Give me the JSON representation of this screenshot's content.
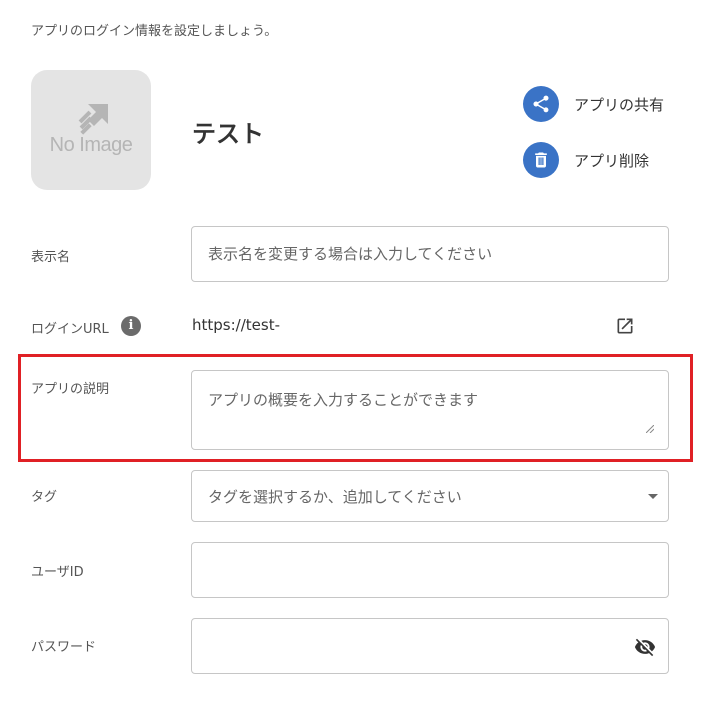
{
  "intro_text": "アプリのログイン情報を設定しましょう。",
  "app": {
    "no_image_text": "No Image",
    "title": "テスト"
  },
  "actions": {
    "share_label": "アプリの共有",
    "delete_label": "アプリ削除"
  },
  "form": {
    "display_name": {
      "label": "表示名",
      "placeholder": "表示名を変更する場合は入力してください",
      "value": ""
    },
    "login_url": {
      "label": "ログインURL",
      "info_glyph": "i",
      "value": "https://test-"
    },
    "description": {
      "label": "アプリの説明",
      "placeholder": "アプリの概要を入力することができます",
      "value": ""
    },
    "tag": {
      "label": "タグ",
      "placeholder": "タグを選択するか、追加してください"
    },
    "user_id": {
      "label": "ユーザID",
      "value": ""
    },
    "password": {
      "label": "パスワード",
      "value": ""
    }
  },
  "icons": {
    "share": "share-icon",
    "delete": "trash-icon",
    "info": "info-icon",
    "open_external": "open-in-new-icon",
    "visibility": "visibility-off-icon",
    "dropdown": "caret-down-icon"
  },
  "colors": {
    "accent": "#3a73c6",
    "highlight": "#e02025",
    "border": "#c6c6c6"
  }
}
